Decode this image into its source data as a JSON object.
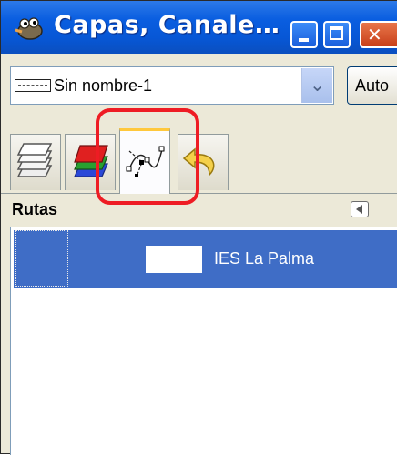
{
  "window": {
    "title": "Capas, Canale…",
    "icon": "gimp-wilber-icon",
    "controls": {
      "minimize": "minimize-icon",
      "maximize": "maximize-icon",
      "close": "close-icon"
    }
  },
  "image_selector": {
    "value": "Sin nombre-1",
    "auto_label": "Auto"
  },
  "tabs": [
    {
      "id": "layers",
      "icon": "layers-icon",
      "active": false
    },
    {
      "id": "channels",
      "icon": "channels-icon",
      "active": false
    },
    {
      "id": "paths",
      "icon": "paths-icon",
      "active": true
    },
    {
      "id": "undo",
      "icon": "undo-history-icon",
      "active": false
    }
  ],
  "dock": {
    "title": "Rutas"
  },
  "paths": [
    {
      "name": "IES La Palma",
      "selected": true
    }
  ],
  "colors": {
    "titlebar": "#0757d6",
    "selection": "#3f6dc6",
    "highlight": "#ee1c24",
    "active_tab_accent": "#ffc83c"
  }
}
